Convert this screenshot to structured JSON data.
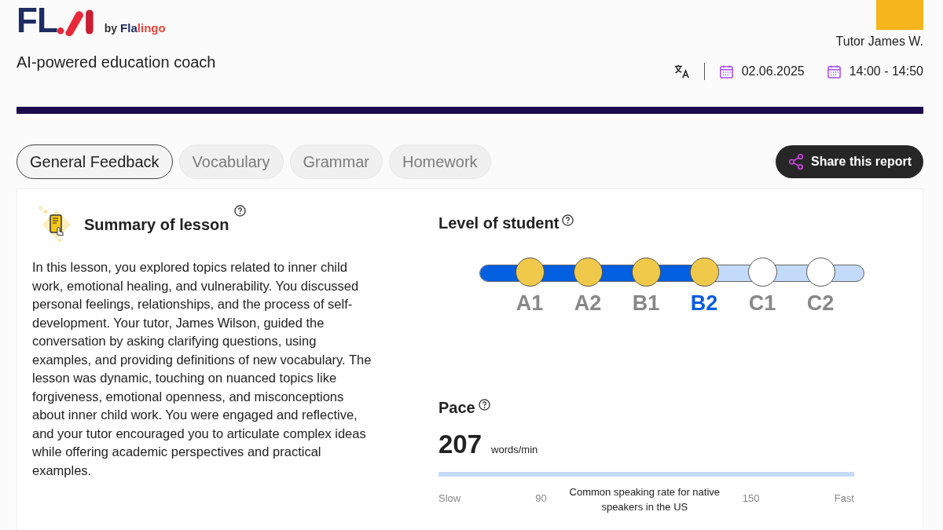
{
  "header": {
    "logo": {
      "letters": "FL",
      "by": "by",
      "brand": [
        "Fla",
        "lingo"
      ]
    },
    "tagline": "AI-powered education coach",
    "tutor": {
      "name": "Tutor James W."
    },
    "date": "02.06.2025",
    "time": "14:00 - 14:50"
  },
  "tabs": [
    {
      "label": "General Feedback",
      "selected": true
    },
    {
      "label": "Vocabulary",
      "selected": false
    },
    {
      "label": "Grammar",
      "selected": false
    },
    {
      "label": "Homework",
      "selected": false
    }
  ],
  "share_button": "Share this report",
  "summary": {
    "title": "Summary of lesson",
    "text": "In this lesson, you explored topics related to inner child work, emotional healing, and vulnerability. You discussed personal feelings, relationships, and the process of self-development. Your tutor, James Wilson, guided the conversation by asking clarifying questions, using examples, and providing definitions of new vocabulary. The lesson was dynamic, touching on nuanced topics like forgiveness, emotional openness, and misconceptions about inner child work. You were engaged and reflective, and your tutor encouraged you to articulate complex ideas while offering academic perspectives and practical examples."
  },
  "level": {
    "title": "Level of student",
    "progress": {
      "level": 0.61
    },
    "steps": [
      {
        "label": "A1",
        "reached": true,
        "selected": false
      },
      {
        "label": "A2",
        "reached": true,
        "selected": false
      },
      {
        "label": "B1",
        "reached": true,
        "selected": false
      },
      {
        "label": "B2",
        "reached": true,
        "selected": true
      },
      {
        "label": "C1",
        "reached": false,
        "selected": false
      },
      {
        "label": "C2",
        "reached": false,
        "selected": false
      }
    ]
  },
  "pace": {
    "title": "Pace",
    "value": "207",
    "unit": "words/min",
    "scale": {
      "slow": "Slow",
      "low": "90",
      "note": "Common speaking rate for native speakers in the US",
      "high": "150",
      "fast": "Fast"
    }
  }
}
